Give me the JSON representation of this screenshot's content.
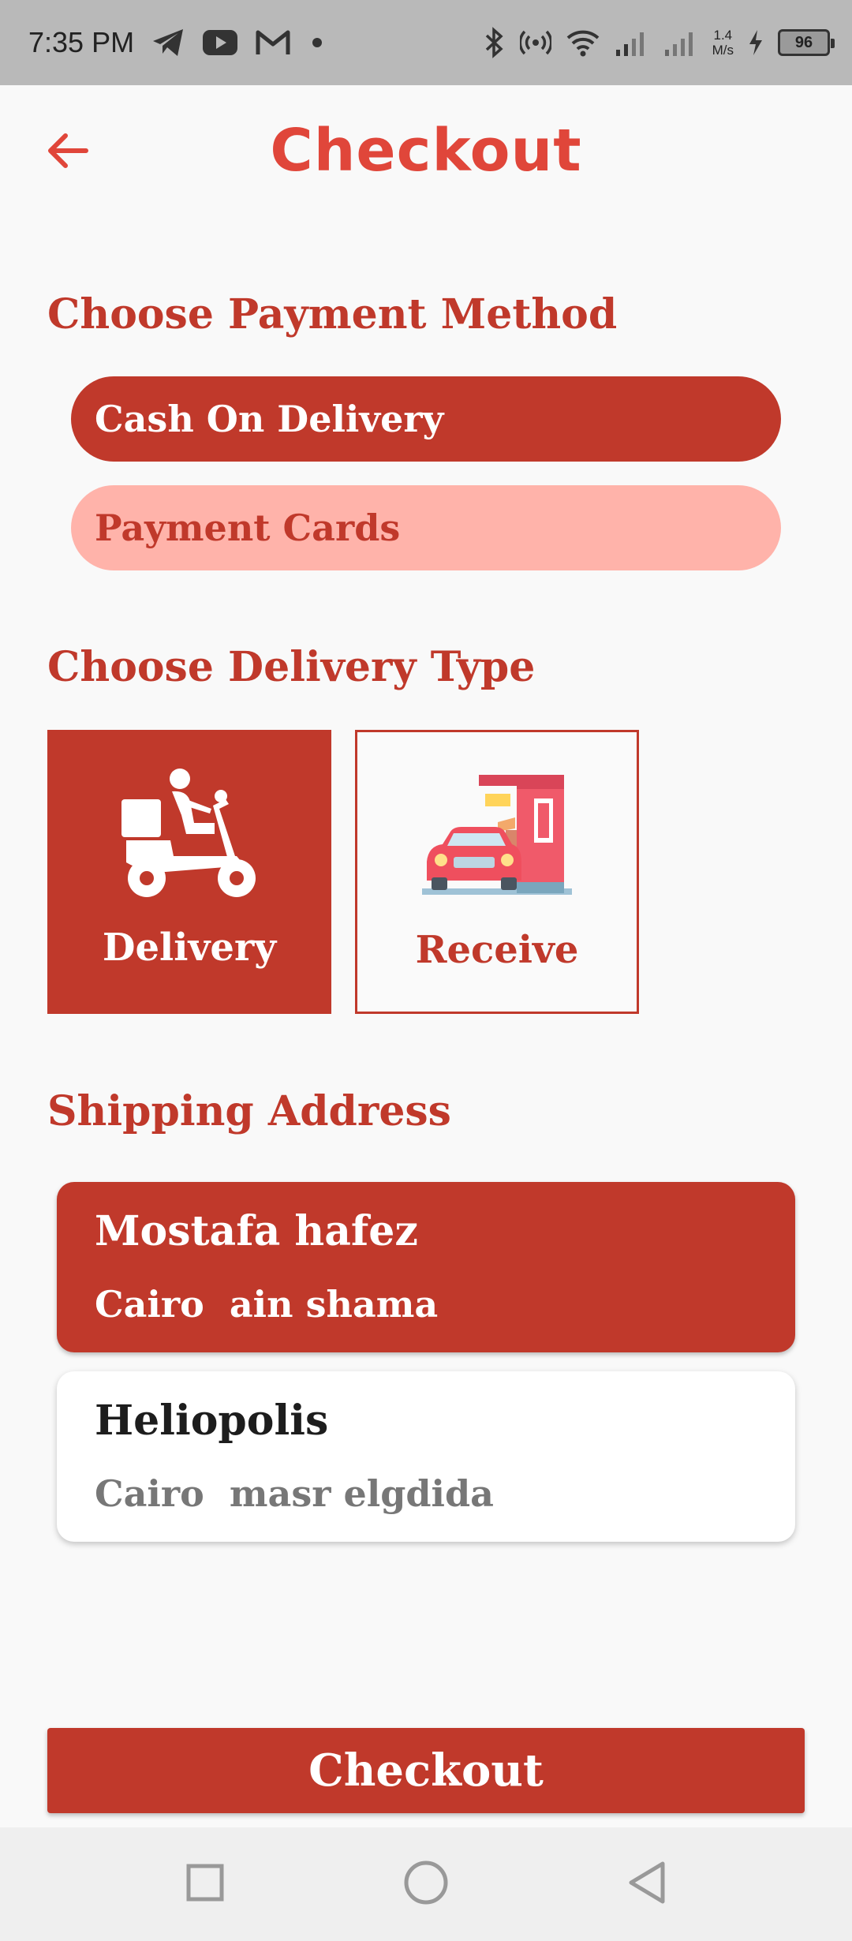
{
  "status_bar": {
    "time": "7:35 PM",
    "speed_value": "1.4",
    "speed_unit": "M/s",
    "battery": "96",
    "icons": [
      "telegram-icon",
      "youtube-icon",
      "gmail-icon",
      "dot-icon",
      "bluetooth-icon",
      "hotspot-icon",
      "wifi-icon",
      "signal-icon",
      "signal-icon",
      "charging-icon",
      "battery-icon"
    ]
  },
  "header": {
    "title": "Checkout",
    "back_icon": "arrow-left-icon"
  },
  "payment": {
    "title": "Choose Payment Method",
    "options": [
      {
        "label": "Cash On Delivery",
        "selected": true
      },
      {
        "label": "Payment Cards",
        "selected": false
      }
    ]
  },
  "delivery": {
    "title": "Choose Delivery Type",
    "options": [
      {
        "label": "Delivery",
        "icon": "scooter-delivery-icon",
        "selected": true
      },
      {
        "label": "Receive",
        "icon": "drive-through-icon",
        "selected": false
      }
    ]
  },
  "shipping": {
    "title": "Shipping Address",
    "addresses": [
      {
        "name": "Mostafa hafez",
        "line": "Cairo  ain shama",
        "selected": true
      },
      {
        "name": "Heliopolis",
        "line": "Cairo  masr elgdida",
        "selected": false
      }
    ]
  },
  "checkout_button": {
    "label": "Checkout"
  },
  "colors": {
    "accent": "#c0392b",
    "title_red": "#e0463a",
    "light_pink": "#ffb3aa",
    "background": "#f9f9f9"
  },
  "nav": {
    "icons": [
      "recent-apps-icon",
      "home-icon",
      "back-icon"
    ]
  }
}
